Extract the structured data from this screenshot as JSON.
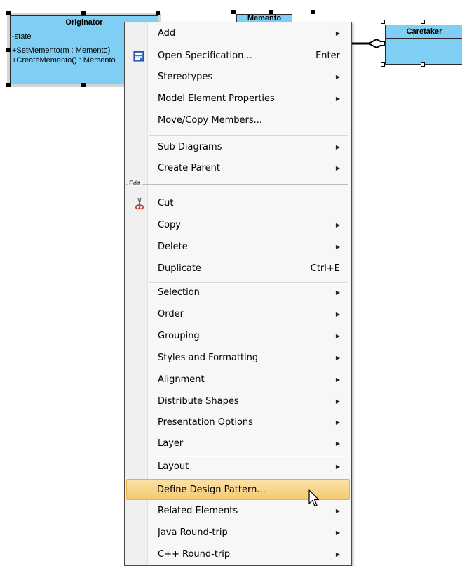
{
  "diagram": {
    "originator": {
      "name": "Originator",
      "attribute": "-state",
      "operations": [
        "+SetMemento(m : Memento)",
        "+CreateMemento() : Memento"
      ]
    },
    "memento": {
      "name": "Memento"
    },
    "caretaker": {
      "name": "Caretaker"
    }
  },
  "context_menu": {
    "items": [
      {
        "label": "Add",
        "submenu": true
      },
      {
        "label": "Open Specification...",
        "shortcut": "Enter",
        "icon": "specification-icon"
      },
      {
        "label": "Stereotypes",
        "submenu": true
      },
      {
        "label": "Model Element Properties",
        "submenu": true
      },
      {
        "label": "Move/Copy Members...",
        "submenu": false
      },
      {
        "label": "Sub Diagrams",
        "submenu": true
      },
      {
        "label": "Create Parent",
        "submenu": true
      },
      {
        "label": "Cut",
        "icon": "scissors-icon"
      },
      {
        "label": "Copy",
        "submenu": true
      },
      {
        "label": "Delete",
        "submenu": true
      },
      {
        "label": "Duplicate",
        "shortcut": "Ctrl+E"
      },
      {
        "label": "Selection",
        "submenu": true
      },
      {
        "label": "Order",
        "submenu": true
      },
      {
        "label": "Grouping",
        "submenu": true
      },
      {
        "label": "Styles and Formatting",
        "submenu": true
      },
      {
        "label": "Alignment",
        "submenu": true
      },
      {
        "label": "Distribute Shapes",
        "submenu": true
      },
      {
        "label": "Presentation Options",
        "submenu": true
      },
      {
        "label": "Layer",
        "submenu": true
      },
      {
        "label": "Layout",
        "submenu": true
      },
      {
        "label": "Define Design Pattern...",
        "highlighted": true
      },
      {
        "label": "Related Elements",
        "submenu": true
      },
      {
        "label": "Java Round-trip",
        "submenu": true
      },
      {
        "label": "C++ Round-trip",
        "submenu": true
      }
    ],
    "edit_section_label": "Edit"
  },
  "colors": {
    "uml_fill": "#7ecff3",
    "highlight": "#f5c971"
  }
}
